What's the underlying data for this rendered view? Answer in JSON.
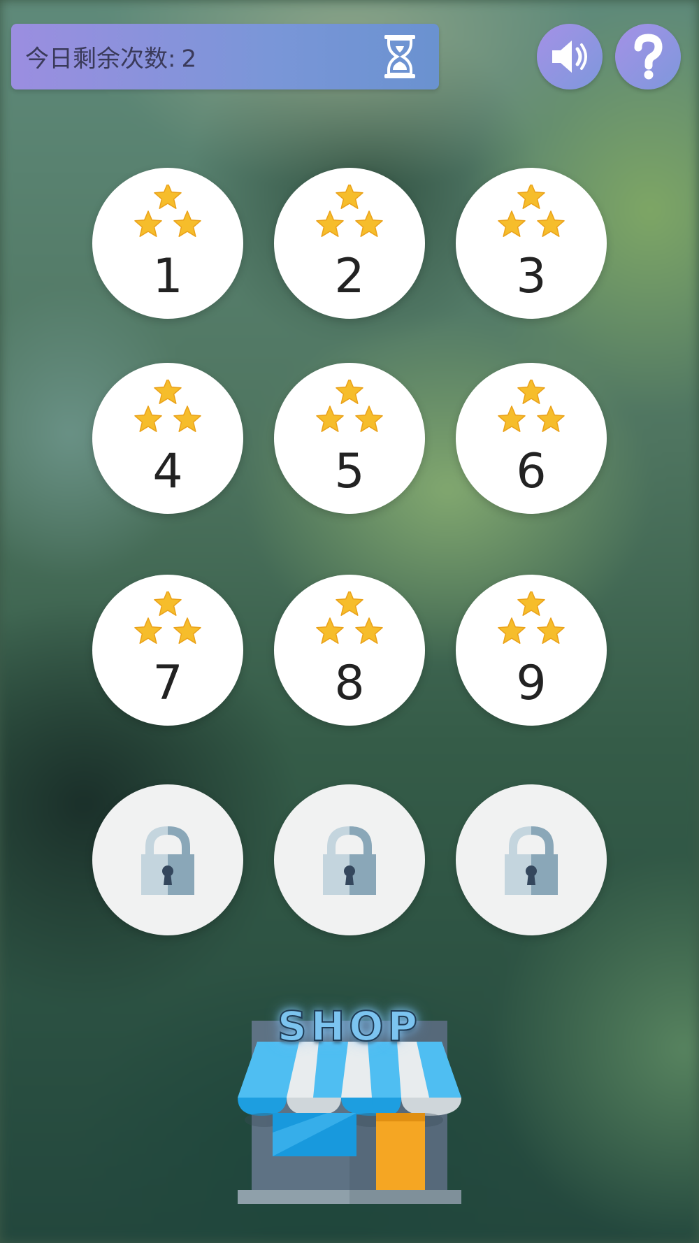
{
  "header": {
    "remaining_label": "今日剩余次数:",
    "remaining_count": "2"
  },
  "icons": {
    "timer": "hourglass-icon",
    "sound": "speaker-icon",
    "help": "question-mark-icon",
    "locked": "padlock-icon",
    "rating": "star-icon"
  },
  "levels": [
    {
      "number": "1",
      "stars": 3,
      "locked": false
    },
    {
      "number": "2",
      "stars": 3,
      "locked": false
    },
    {
      "number": "3",
      "stars": 3,
      "locked": false
    },
    {
      "number": "4",
      "stars": 3,
      "locked": false
    },
    {
      "number": "5",
      "stars": 3,
      "locked": false
    },
    {
      "number": "6",
      "stars": 3,
      "locked": false
    },
    {
      "number": "7",
      "stars": 3,
      "locked": false
    },
    {
      "number": "8",
      "stars": 3,
      "locked": false
    },
    {
      "number": "9",
      "stars": 3,
      "locked": false
    },
    {
      "number": "",
      "stars": 0,
      "locked": true
    },
    {
      "number": "",
      "stars": 0,
      "locked": true
    },
    {
      "number": "",
      "stars": 0,
      "locked": true
    }
  ],
  "shop": {
    "sign": "SHOP"
  },
  "colors": {
    "header_gradient_start": "#9b8ee0",
    "header_gradient_end": "#6a92d0",
    "star": "#f6bd2b",
    "lock": "#8aa7b8",
    "awning_blue": "#3ab4ee",
    "door_orange": "#f5a623"
  }
}
